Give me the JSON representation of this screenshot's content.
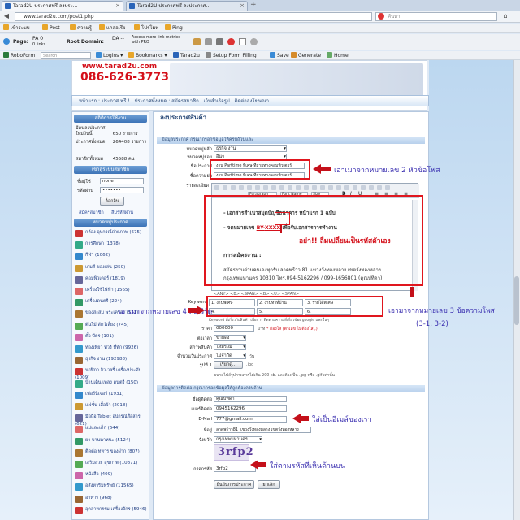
{
  "browser": {
    "tabs": [
      {
        "label": "Tarad2U ประกาศฟรี ลงประ..."
      },
      {
        "label": "Tarad2U ประกาศฟรี ลงประกาศ..."
      }
    ],
    "url": "www.tarad2u.com/post1.php",
    "search_placeholder": "ค้นหา",
    "bookmarks": [
      "เข้าระบบ",
      "Post",
      "ความรู้",
      "แกลอเรีย",
      "โปรโมท",
      "Ping"
    ],
    "seo_toolbar": {
      "page_label": "Page:",
      "pa": "PA 0",
      "links": "0 links",
      "root_label": "Root Domain:",
      "da": "DA --",
      "more": "Access more link metrics with PRO"
    },
    "robo_toolbar": {
      "roboform": "RoboForm",
      "search": "Search",
      "logins": "Logins",
      "bookmarks": "Bookmarks",
      "tarad2u": "Tarad2u",
      "setup": "Setup Form Filling",
      "save": "Save",
      "generate": "Generate",
      "home": "Home"
    }
  },
  "banner": {
    "site": "www.tarad2u.com",
    "phone": "086-626-3773"
  },
  "nav": "หน้าแรก : ประกาศ ฟรี ! : ประกาศทั้งหมด : สมัครสมาชิก : เว็บลำเร็จรูป : ติดต่อลงโฆษณา",
  "sidebar": {
    "stats_title": "สถิติการใช้งาน",
    "stats": [
      {
        "label": "มีคนลงประกาศใหม่วันนี้",
        "value": "650",
        "unit": "รายการ"
      },
      {
        "label": "ประกาศทั้งหมด",
        "value": "264408",
        "unit": "รายการ"
      },
      {
        "label": "สมาชิกทั้งหมด",
        "value": "45588",
        "unit": "คน"
      }
    ],
    "login_title": "เข้าสู่ระบบสมาชิก",
    "username_label": "ชื่อผู้ใช้",
    "username_value": "none",
    "password_label": "รหัสผ่าน",
    "password_value": "•••••••",
    "login_button": "ล็อกอิน",
    "register_link": "สมัครสมาชิก",
    "forgot_link": "ลืมรหัสผ่าน",
    "cat_title": "หมวดหมู่ประกาศ",
    "categories": [
      "กล้อง อุปกรณ์ถ่ายภาพ (675)",
      "การศึกษา (1378)",
      "กีฬา (1062)",
      "เกมส์ ของเล่น (250)",
      "คอมพิวเตอร์ (1819)",
      "เครื่องใช้ไฟฟ้า (1565)",
      "เครื่องดนตรี (224)",
      "ของสะสม พระเครื่อง (521)",
      "ต้นไม้ สัตว์เลี้ยง (745)",
      "ตั๋ว บัตร (101)",
      "ท่องเที่ยว ทัวร์ ที่พัก (9926)",
      "ธุรกิจ งาน (192988)",
      "นาฬิกา จิวเวลรี่ เครื่องประดับ (1009)",
      "บ้านเดิน เพลง ดนตรี (150)",
      "เฟอร์นิเจอร์ (1931)",
      "แฟชั่น เสื้อผ้า (2018)",
      "มือถือ Tablet อุปกรณ์สื่อสาร (621)",
      "แม่และเด็ก (644)",
      "ยา บานพาหนะ (5124)",
      "ติดต่อ ทหาร ของฝาก (807)",
      "เสริมสวย สุขภาพ (10871)",
      "หนังสือ (409)",
      "อสังหาริมทรัพย์ (11565)",
      "อาหาร (968)",
      "อุตสาหกรรม เครื่องจักร (5946)"
    ]
  },
  "form": {
    "title": "ลงประกาศสินค้า",
    "section1": "ข้อมูลประกาศ กรุณากรอกข้อมูลให้ครบถ้วนและ",
    "fields": {
      "main_cat_label": "หมวดหมู่หลัก",
      "main_cat_value": "ธุรกิจ งาน",
      "sub_cat_label": "หมวดหมู่ย่อย",
      "sub_cat_value": "อื่นๆ",
      "title_label": "ชื่อประกาศ",
      "title_value": "งาน Parttime พิเศษ ที่ถ่ายทางคอมพิวเตอร์",
      "short_title_label": "ชื่อความย่อ",
      "short_title_value": "งาน Parttime พิเศษ ที่ถ่ายทางคอมพิวเตอร์",
      "detail_label": "รายละเอียด",
      "paragraph_select": "Paragraph",
      "font_select": "Font Name",
      "size_select": "Size",
      "keyword_label": "Keyword",
      "keyword_tags": "<ANY> <B> <SPAN> <B> <U> <SPAN>",
      "keywords": [
        "1. งานพิเศษ",
        "2. งานทำที่บ้าน",
        "3. รายได้พิเศษ",
        "4.",
        "5.",
        "6."
      ],
      "keyword_note": "Keyword ที่เกี่ยวกับสินค้า เพื่อการ ติดตามความที่เกี่ยวข้อง google และอื่นๆ",
      "price_label": "ราคา",
      "price_value": "000000",
      "price_unit": "บาท",
      "price_note": "* ต้องใส่ (ตัวเลข ไม่ต้องใส่ ,)",
      "status_label": "ต่อเวลา",
      "status_value": "ขายดีง",
      "condition_label": "สภาพสินค้า",
      "condition_value": "ใหม่รวม",
      "duration_label": "จำนวนวันประกาศ",
      "duration_value": "ไม่จำกัด",
      "duration_unit": "วัน",
      "image_label": "รูปที่ 1",
      "browse_button": "เรียกดู...",
      "file_name": ".jpg",
      "image_note": "ขนาดไฟล์รูปภาพควรไม่เกิน 200 kb. และต้องเป็น .jpg หรือ .gif เท่านั้น"
    },
    "editor_lines": [
      "- เอกสารสำเนาสมุดบัญชีธนาคาร หน้าแรก 1 ฉบับ",
      "- จดหมายเลข",
      "เพื่อรับเอกสารการทำงาน",
      "การสมัครงาน :",
      "สมัครงานด่วนคนเองทุกรับ ลาดพร้าว 81 แขวงวังทองหลาง เขตวังทองหลาง",
      "กรุงเทพมหานคร 10310 โทร.094-5162296 / 099-1656801 (คุณปทิดา)"
    ],
    "code_prefix": "BY-",
    "code_value": "XXXX",
    "section2": "ข้อมูลการติดต่อ กรุณากรอกข้อมูลให้ถูกต้องครบถ้วน",
    "contact": {
      "name_label": "ชื่อผู้ติดต่อ",
      "name_value": "คุณปทิดา",
      "phone_label": "เบอร์ติดต่อ",
      "phone_value": "0945162296",
      "email_label": "E-Mail",
      "email_value": "777@gmail.com",
      "address_label": "ที่อยู่",
      "address_value": "ลาดพร้าว81 แขวงวังทองหลาง เขตวังทองหลาง",
      "province_label": "จังหวัด",
      "province_value": "กรุงเทพมหานคร",
      "captcha_text": "3rfp2",
      "captcha_label": "กรอกรหัส",
      "captcha_value": "3rfp2"
    },
    "submit_button": "ยืนยันการประกาศ",
    "cancel_button": "ยกเลิก"
  },
  "annotations": {
    "a1": "เอาเมาจากหมายเลข 2 หัวข้อโพส",
    "a2": "อย่า!! ลืมเปลี่ยนเป็นรหัสตัวเอง",
    "a3": "เอาเมาจากหมายเลข 4 คีย์เวิร์ด",
    "a4": "เอามาจากหมายเลข 3 ข้อความโพส",
    "a4b": "(3-1, 3-2)",
    "a5": "ใส่เป็นอีเมล์ของเรา",
    "a6": "ใส่ตามรหัสที่เห็นด้านบน"
  }
}
